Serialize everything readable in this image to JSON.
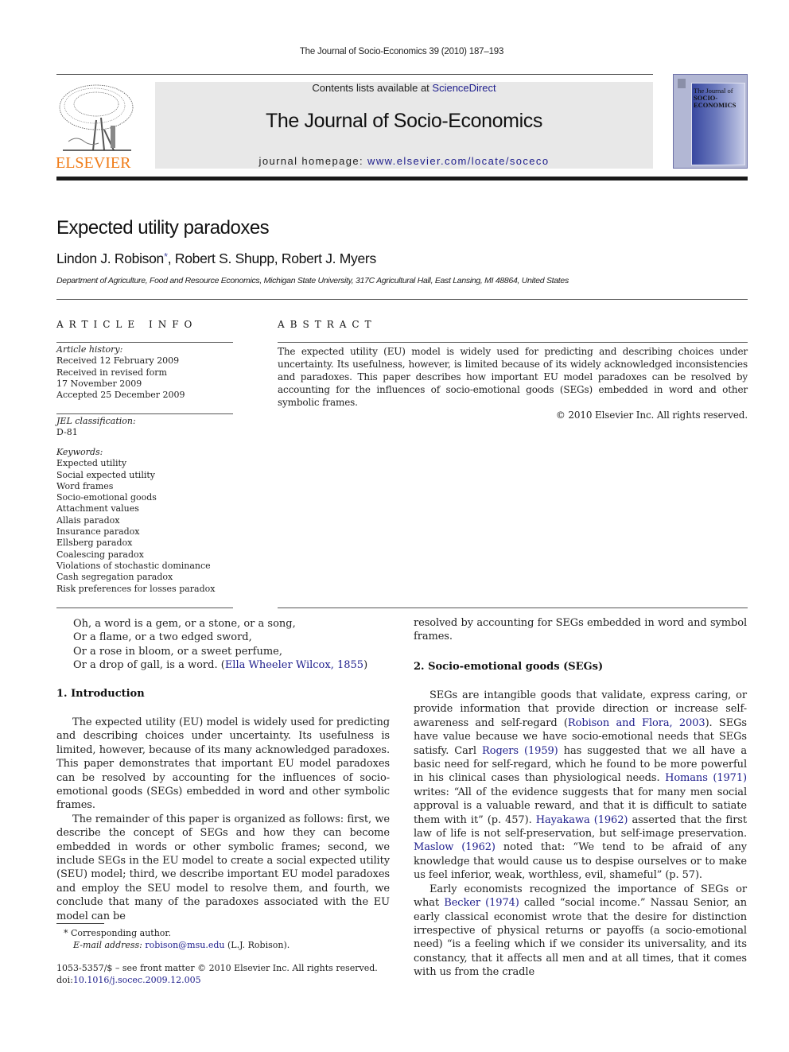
{
  "header": {
    "running_head": "The Journal of Socio-Economics 39 (2010) 187–193",
    "contents_prefix": "Contents lists available at ",
    "contents_link": "ScienceDirect",
    "journal_title": "The Journal of Socio-Economics",
    "homepage_prefix": "journal homepage: ",
    "homepage_link": "www.elsevier.com/locate/soceco",
    "publisher_logo_text": "ELSEVIER",
    "cover": {
      "line1": "The Journal of",
      "line2": "SOCIO-",
      "line3": "ECONOMICS"
    },
    "colors": {
      "elsevier_orange": "#f07c18",
      "link_blue": "#1d1d8c",
      "banner_gray": "#e8e8e8"
    }
  },
  "article": {
    "title": "Expected utility paradoxes",
    "authors": {
      "author1": "Lindon J. Robison",
      "author1_marker": "*",
      "rest": ", Robert S. Shupp, Robert J. Myers"
    },
    "affiliation": "Department of Agriculture, Food and Resource Economics, Michigan State University, 317C Agricultural Hall, East Lansing, MI 48864, United States"
  },
  "article_info": {
    "heading": "ARTICLE INFO",
    "history_label": "Article history:",
    "history": [
      "Received 12 February 2009",
      "Received in revised form",
      "17 November 2009",
      "Accepted 25 December 2009"
    ],
    "jel_label": "JEL classification:",
    "jel": "D-81",
    "keywords_label": "Keywords:",
    "keywords": [
      "Expected utility",
      "Social expected utility",
      "Word frames",
      "Socio-emotional goods",
      "Attachment values",
      "Allais paradox",
      "Insurance paradox",
      "Ellsberg paradox",
      "Coalescing paradox",
      "Violations of stochastic dominance",
      "Cash segregation paradox",
      "Risk preferences for losses paradox"
    ]
  },
  "abstract": {
    "heading": "ABSTRACT",
    "text": "The expected utility (EU) model is widely used for predicting and describing choices under uncertainty. Its usefulness, however, is limited because of its widely acknowledged inconsistencies and paradoxes. This paper describes how important EU model paradoxes can be resolved by accounting for the influences of socio-emotional goods (SEGs) embedded in word and other symbolic frames.",
    "copyright": "© 2010 Elsevier Inc. All rights reserved."
  },
  "epigraph": {
    "lines": [
      "Oh, a word is a gem, or a stone, or a song,",
      "Or a flame, or a two edged sword,",
      "Or a rose in bloom, or a sweet perfume,",
      "Or a drop of gall, is a word. ("
    ],
    "citation": "Ella Wheeler Wilcox, 1855",
    "close": ")"
  },
  "section1": {
    "heading": "1.  Introduction",
    "p1": "The expected utility (EU) model is widely used for predicting and describing choices under uncertainty. Its usefulness is limited, however, because of its many acknowledged paradoxes. This paper demonstrates that important EU model paradoxes can be resolved by accounting for the influences of socio-emotional goods (SEGs) embedded in word and other symbolic frames.",
    "p2": "The remainder of this paper is organized as follows: first, we describe the concept of SEGs and how they can become embedded in words or other symbolic frames; second, we include SEGs in the EU model to create a social expected utility (SEU) model; third, we describe important EU model paradoxes and employ the SEU model to resolve them, and fourth, we conclude that many of the paradoxes associated with the EU model can be",
    "p2_cont": "resolved by accounting for SEGs embedded in word and symbol frames."
  },
  "section2": {
    "heading": "2.  Socio-emotional goods (SEGs)",
    "p1": [
      {
        "t": "SEGs are intangible goods that validate, express caring, or provide information that provide direction or increase self-awareness and self-regard ("
      },
      {
        "link": "Robison and Flora, 2003"
      },
      {
        "t": "). SEGs have value because we have socio-emotional needs that SEGs satisfy. Carl "
      },
      {
        "link": "Rogers (1959)"
      },
      {
        "t": " has suggested that we all have a basic need for self-regard, which he found to be more powerful in his clinical cases than physiological needs. "
      },
      {
        "link": "Homans (1971)"
      },
      {
        "t": " writes: “All of the evidence suggests that for many men social approval is a valuable reward, and that it is difficult to satiate them with it” (p. 457). "
      },
      {
        "link": "Hayakawa (1962)"
      },
      {
        "t": " asserted that the first law of life is not self-preservation, but self-image preservation. "
      },
      {
        "link": "Maslow (1962)"
      },
      {
        "t": " noted that: “We tend to be afraid of any knowledge that would cause us to despise ourselves or to make us feel inferior, weak, worthless, evil, shameful” (p. 57)."
      }
    ],
    "p2": [
      {
        "t": "Early economists recognized the importance of SEGs or what "
      },
      {
        "link": "Becker (1974)"
      },
      {
        "t": " called “social income.” Nassau Senior, an early classical economist wrote that the desire for distinction irrespective of physical returns or payoffs (a socio-emotional need) “is a feeling which if we consider its universality, and its constancy, that it affects all men and at all times, that it comes with us from the cradle"
      }
    ]
  },
  "footnotes": {
    "marker": "*",
    "corresponding": "Corresponding author.",
    "email_label": "E-mail address:",
    "email": "robison@msu.edu",
    "email_suffix": " (L.J. Robison).",
    "front_matter": "1053-5357/$ – see front matter © 2010 Elsevier Inc. All rights reserved.",
    "doi_prefix": "doi:",
    "doi": "10.1016/j.socec.2009.12.005"
  }
}
